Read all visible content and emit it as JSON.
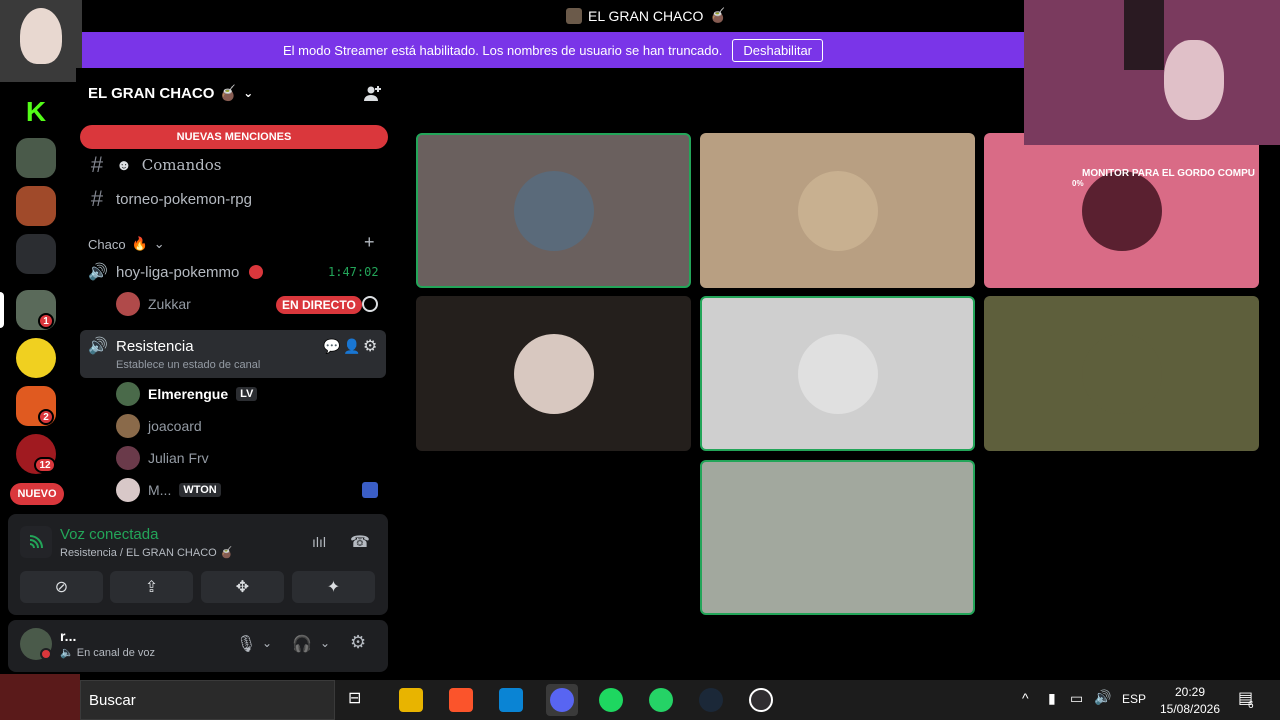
{
  "window": {
    "title": "EL GRAN CHACO",
    "title_emoji": "🧉"
  },
  "banner": {
    "message": "El modo Streamer está habilitado. Los nombres de usuario se han truncado.",
    "button": "Deshabilitar"
  },
  "rail": {
    "nuevo": "NUEVO",
    "badges": [
      "1",
      "2",
      "12"
    ]
  },
  "server": {
    "name": "EL GRAN CHACO 🧉"
  },
  "sidebar": {
    "mentions": "NUEVAS MENCIONES",
    "channels": [
      {
        "type": "text",
        "label": "Comandos"
      },
      {
        "type": "text",
        "label": "torneo-pokemon-rpg"
      }
    ],
    "category": "Chaco",
    "live_channel": {
      "name": "hoy-liga-pokemmo",
      "time": "1:47:02",
      "user": "Zukkar",
      "live_badge": "EN DIRECTO"
    },
    "voice_channel": {
      "name": "Resistencia",
      "status_placeholder": "Establece un estado de canal"
    },
    "members": [
      {
        "name": "Elmerengue",
        "tag": "LV",
        "color": "#4a6a4a"
      },
      {
        "name": "joacoard",
        "tag": "",
        "color": "#8a6a4a"
      },
      {
        "name": "Julian Frv",
        "tag": "",
        "color": "#6a3a4a"
      },
      {
        "name": "M...",
        "tag": "WTON",
        "color": "#d8c8c8"
      }
    ]
  },
  "voice_panel": {
    "status": "Voz conectada",
    "channel": "Resistencia / EL GRAN CHACO 🧉"
  },
  "user_panel": {
    "name": "r...",
    "status": "En canal de voz"
  },
  "grid": [
    {
      "bg": "#6a605e",
      "speaking": true,
      "av": "#5a6a7a"
    },
    {
      "bg": "#b89f82",
      "speaking": false,
      "av": "#c8b090"
    },
    {
      "bg": "#d96b86",
      "speaking": false,
      "av": "#5a2030"
    },
    {
      "bg": "#241f1c",
      "speaking": false,
      "av": "#d8c8c0"
    },
    {
      "bg": "#cfcfcf",
      "speaking": true,
      "av": "#e0e0e0"
    },
    {
      "bg": "#5e5f3c",
      "speaking": false,
      "av": "#5e5f3c"
    },
    {
      "bg": "#a2a89e",
      "speaking": true,
      "av": "#a2a89e"
    }
  ],
  "overlay": {
    "label": "MONITOR PARA EL GORDO COMPU",
    "percent": "0%"
  },
  "taskbar": {
    "search": "Buscar",
    "lang": "ESP",
    "time": "20:29",
    "date": "15/08/2026",
    "notif": "6"
  }
}
